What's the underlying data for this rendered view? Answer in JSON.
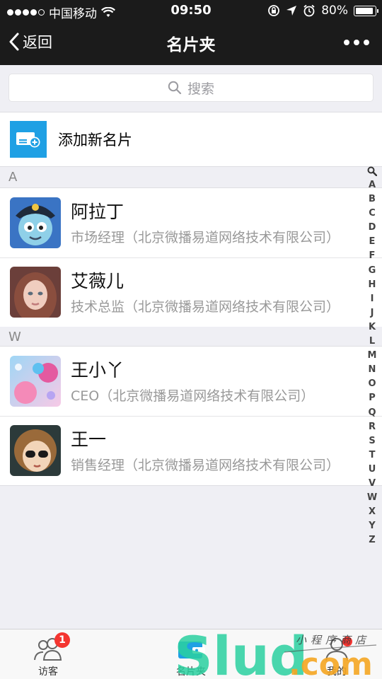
{
  "status_bar": {
    "carrier": "中国移动",
    "time": "09:50",
    "battery": "80%",
    "battery_level": 0.8
  },
  "nav": {
    "back_label": "返回",
    "title": "名片夹"
  },
  "search": {
    "placeholder": "搜索"
  },
  "add_card": {
    "label": "添加新名片"
  },
  "sections": [
    {
      "letter": "A",
      "contacts": [
        {
          "name": "阿拉丁",
          "title": "市场经理（北京微播易道网络技术有限公司）"
        },
        {
          "name": "艾薇儿",
          "title": "技术总监（北京微播易道网络技术有限公司）"
        }
      ]
    },
    {
      "letter": "W",
      "contacts": [
        {
          "name": "王小丫",
          "title": "CEO（北京微播易道网络技术有限公司）"
        },
        {
          "name": "王一",
          "title": "销售经理（北京微播易道网络技术有限公司）"
        }
      ]
    }
  ],
  "alpha_index": [
    "A",
    "B",
    "C",
    "D",
    "E",
    "F",
    "G",
    "H",
    "I",
    "J",
    "K",
    "L",
    "M",
    "N",
    "O",
    "P",
    "Q",
    "R",
    "S",
    "T",
    "U",
    "V",
    "W",
    "X",
    "Y",
    "Z"
  ],
  "tabs": [
    {
      "label": "访客",
      "badge": "1"
    },
    {
      "label": "名片夹"
    },
    {
      "label": "我的"
    }
  ],
  "watermark": {
    "brand": "Slud.com",
    "handwriting": "小程序商店"
  },
  "colors": {
    "header_bg": "#1b1b1b",
    "add_icon_bg": "#1fa0e4",
    "badge_red": "#f43530",
    "watermark_green": "#2bd1a0",
    "watermark_orange": "#f5a623"
  }
}
